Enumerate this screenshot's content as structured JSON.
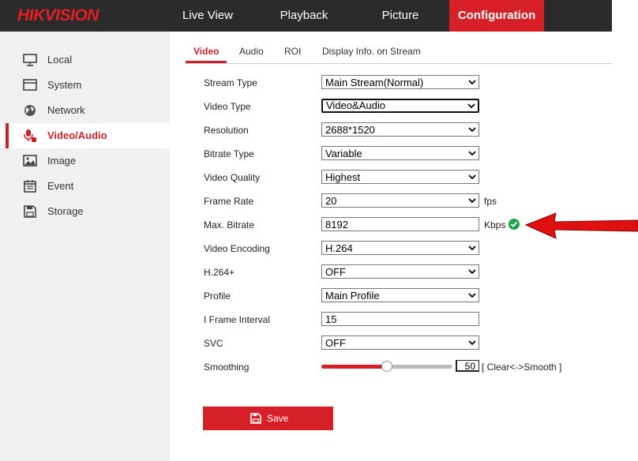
{
  "header": {
    "brand": "HIKVISION",
    "nav": [
      "Live View",
      "Playback",
      "Picture",
      "Configuration"
    ]
  },
  "sidebar": {
    "items": [
      {
        "label": "Local",
        "icon": "monitor-icon"
      },
      {
        "label": "System",
        "icon": "system-window-icon"
      },
      {
        "label": "Network",
        "icon": "globe-icon"
      },
      {
        "label": "Video/Audio",
        "icon": "microphone-camera-icon"
      },
      {
        "label": "Image",
        "icon": "picture-icon"
      },
      {
        "label": "Event",
        "icon": "calendar-icon"
      },
      {
        "label": "Storage",
        "icon": "floppy-disk-icon"
      }
    ],
    "active": "Video/Audio"
  },
  "tabs": [
    "Video",
    "Audio",
    "ROI",
    "Display Info. on Stream"
  ],
  "form": {
    "stream_type": {
      "label": "Stream Type",
      "value": "Main Stream(Normal)"
    },
    "video_type": {
      "label": "Video Type",
      "value": "Video&Audio"
    },
    "resolution": {
      "label": "Resolution",
      "value": "2688*1520"
    },
    "bitrate_type": {
      "label": "Bitrate Type",
      "value": "Variable"
    },
    "video_quality": {
      "label": "Video Quality",
      "value": "Highest"
    },
    "frame_rate": {
      "label": "Frame Rate",
      "value": "20",
      "unit": "fps"
    },
    "max_bitrate": {
      "label": "Max. Bitrate",
      "value": "8192",
      "unit": "Kbps"
    },
    "video_encoding": {
      "label": "Video Encoding",
      "value": "H.264"
    },
    "h264plus": {
      "label": "H.264+",
      "value": "OFF"
    },
    "profile": {
      "label": "Profile",
      "value": "Main Profile"
    },
    "i_frame_interval": {
      "label": "I Frame Interval",
      "value": "15"
    },
    "svc": {
      "label": "SVC",
      "value": "OFF"
    },
    "smoothing": {
      "label": "Smoothing",
      "value": "50",
      "hint": "[ Clear<->Smooth ]",
      "level": 50
    }
  },
  "save_label": "Save",
  "colors": {
    "accent": "#d71f27",
    "topbar": "#2b2b2b",
    "sidebar": "#f0f0f0",
    "valid": "#1fa24a"
  }
}
